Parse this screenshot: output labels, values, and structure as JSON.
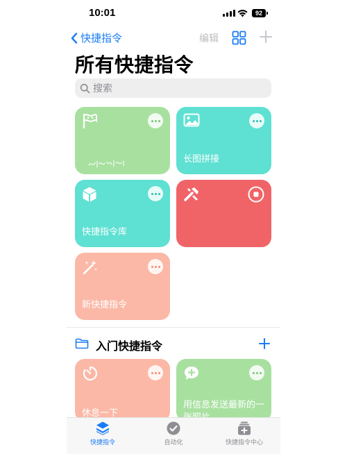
{
  "status": {
    "time": "10:01",
    "battery": "92"
  },
  "nav": {
    "back_label": "快捷指令",
    "edit_label": "编辑"
  },
  "page_title": "所有快捷指令",
  "search": {
    "placeholder": "搜索"
  },
  "shortcuts": [
    {
      "label": "",
      "color": "#a8e0a0",
      "icon": "flag-icon"
    },
    {
      "label": "长图拼接",
      "color": "#5ee0d2",
      "icon": "photo-icon"
    },
    {
      "label": "快捷指令库",
      "color": "#5ee0d2",
      "icon": "cube-icon"
    },
    {
      "label": "",
      "color": "#f06468",
      "icon": "tools-icon"
    },
    {
      "label": "新快捷指令",
      "color": "#fbb8a6",
      "icon": "magic-wand-icon"
    }
  ],
  "section": {
    "title": "入门快捷指令"
  },
  "starter_shortcuts": [
    {
      "label": "休息一下",
      "color": "#fbb8a6",
      "icon": "timer-icon"
    },
    {
      "label": "用信息发送最新的一张照片",
      "color": "#a8e0a0",
      "icon": "message-add-icon"
    }
  ],
  "tabs": [
    {
      "label": "快捷指令",
      "active": true
    },
    {
      "label": "自动化",
      "active": false
    },
    {
      "label": "快捷指令中心",
      "active": false
    }
  ],
  "colors": {
    "accent": "#1a7cf5"
  }
}
